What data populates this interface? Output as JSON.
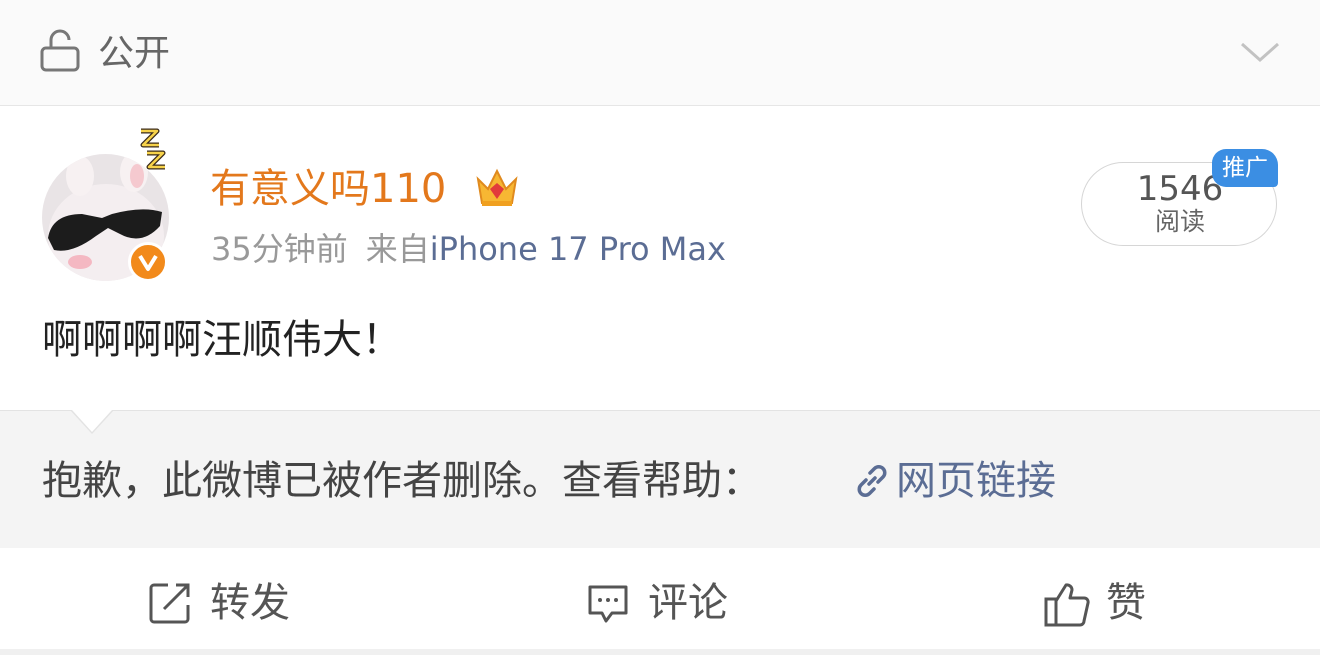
{
  "header": {
    "visibility_label": "公开",
    "lock_icon": "lock-open-icon",
    "collapse_icon": "chevron-down-icon"
  },
  "post": {
    "username": "有意义吗110",
    "username_color": "#e3781c",
    "time": "35分钟前",
    "source_prefix": "来自",
    "source_device": "iPhone 17 Pro Max",
    "read_count": "1546",
    "read_label": "阅读",
    "promo_tag": "推广",
    "text": "啊啊啊啊汪顺伟大！"
  },
  "deleted_notice": {
    "message": "抱歉，此微博已被作者删除。查看帮助：",
    "link_label": "网页链接",
    "link_color": "#5b6d94"
  },
  "actions": {
    "repost": "转发",
    "comment": "评论",
    "like": "赞"
  }
}
